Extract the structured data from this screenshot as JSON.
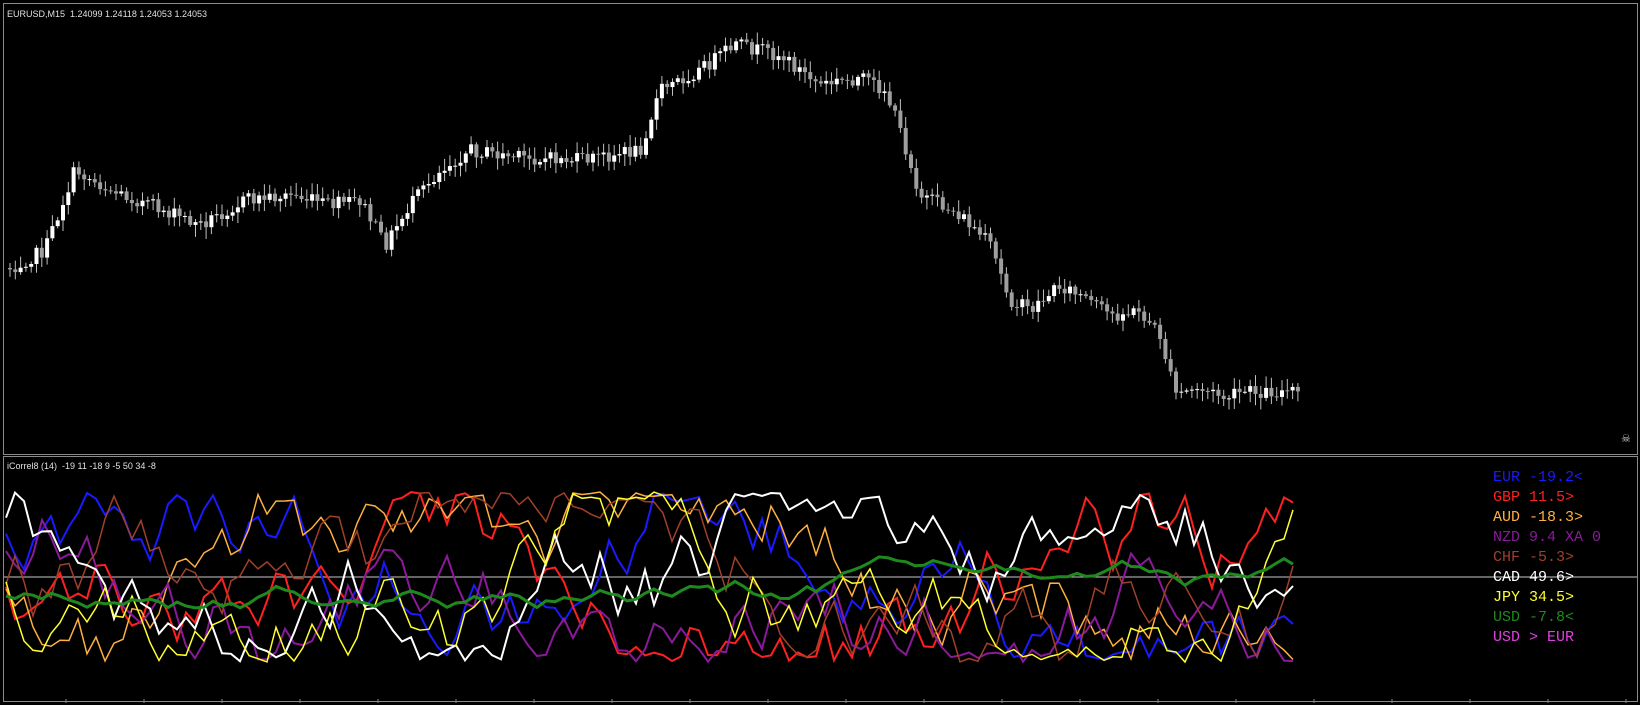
{
  "chart": {
    "title": "EURUSD,M15  1.24099 1.24118 1.24053 1.24053",
    "candle_colors": {
      "body": "#ffffff",
      "wick": "#c0c0c0",
      "bear": "#9e9e9e"
    }
  },
  "indicator": {
    "title": "iCorrel8 (14)  -19 11 -18 9 -5 50 34 -8",
    "zero_line_color": "#c8c8c8",
    "legend": [
      {
        "text": "EUR -19.2<",
        "color": "#1a1aff"
      },
      {
        "text": "GBP 11.5>",
        "color": "#ff2020"
      },
      {
        "text": "AUD -18.3>",
        "color": "#ffb040"
      },
      {
        "text": "NZD 9.4 XA 0",
        "color": "#8a1a9a"
      },
      {
        "text": "CHF -5.3>",
        "color": "#a0402a"
      },
      {
        "text": "CAD 49.6>",
        "color": "#ffffff"
      },
      {
        "text": "JPY 34.5>",
        "color": "#ffff30"
      },
      {
        "text": "USD -7.8<",
        "color": "#1e8a1e"
      },
      {
        "text": "USD > EUR",
        "color": "#e040e0"
      }
    ],
    "series_names": [
      "EUR",
      "GBP",
      "AUD",
      "NZD",
      "CHF",
      "CAD",
      "JPY",
      "USD"
    ]
  },
  "status_icon": "skull-icon"
}
